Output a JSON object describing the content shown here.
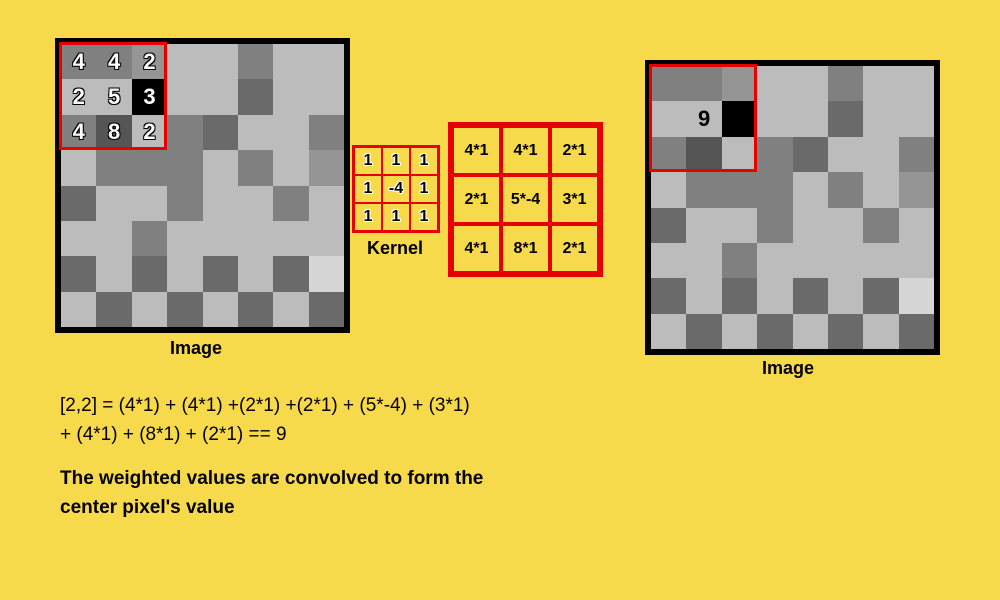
{
  "left_image": {
    "label": "Image",
    "overlay_values": [
      [
        4,
        4,
        2
      ],
      [
        2,
        5,
        3
      ],
      [
        4,
        8,
        2
      ]
    ],
    "highlight_box": {
      "top": 0,
      "left": 0,
      "size": 3
    }
  },
  "right_image": {
    "label": "Image",
    "result_value": 9,
    "highlight_box": {
      "top": 0,
      "left": 0,
      "size": 3
    }
  },
  "kernel": {
    "label": "Kernel",
    "values": [
      [
        1,
        1,
        1
      ],
      [
        1,
        -4,
        1
      ],
      [
        1,
        1,
        1
      ]
    ]
  },
  "calculation": {
    "cells": [
      [
        "4*1",
        "4*1",
        "2*1"
      ],
      [
        "2*1",
        "5*-4",
        "3*1"
      ],
      [
        "4*1",
        "8*1",
        "2*1"
      ]
    ]
  },
  "equation_line1": "[2,2] = (4*1) + (4*1) +(2*1) +(2*1) + (5*-4) + (3*1)",
  "equation_line2": "+ (4*1) + (8*1) + (2*1) == 9",
  "explanation": "The weighted values are convolved to form the center pixel's value",
  "grid_shades": [
    [
      5,
      5,
      6,
      7,
      7,
      5,
      7,
      7
    ],
    [
      7,
      7,
      0,
      7,
      7,
      4,
      7,
      7
    ],
    [
      5,
      3,
      7,
      5,
      4,
      7,
      7,
      5
    ],
    [
      7,
      5,
      5,
      5,
      7,
      5,
      7,
      6
    ],
    [
      4,
      7,
      7,
      5,
      7,
      7,
      5,
      7
    ],
    [
      7,
      7,
      5,
      7,
      7,
      7,
      7,
      7
    ],
    [
      4,
      7,
      4,
      7,
      4,
      7,
      4,
      8
    ],
    [
      7,
      4,
      7,
      4,
      7,
      4,
      7,
      4
    ]
  ],
  "shade_palette": [
    "#000000",
    "#2a2a2a",
    "#404040",
    "#555555",
    "#6a6a6a",
    "#808080",
    "#959595",
    "#bcbcbc",
    "#d6d6d6"
  ]
}
